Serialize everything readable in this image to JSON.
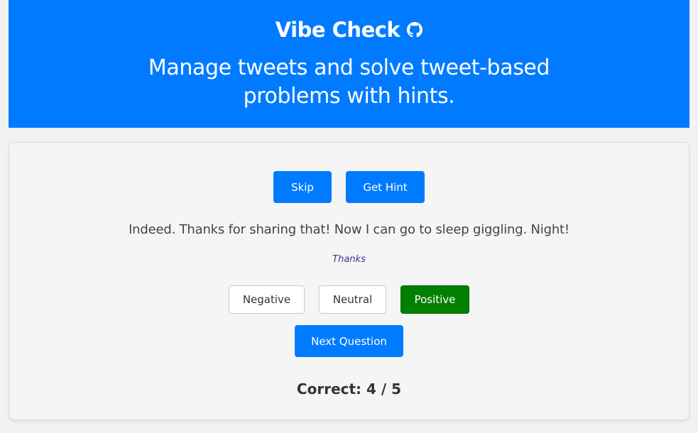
{
  "header": {
    "title": "Vibe Check",
    "icon": "github-icon",
    "subtitle": "Manage tweets and solve tweet-based problems with hints."
  },
  "controls": {
    "skip_label": "Skip",
    "hint_label": "Get Hint"
  },
  "tweet": {
    "text": "Indeed. Thanks for sharing that! Now I can go to sleep giggling. Night!",
    "hint": "Thanks"
  },
  "sentiments": {
    "negative_label": "Negative",
    "neutral_label": "Neutral",
    "positive_label": "Positive",
    "selected": "Positive"
  },
  "next_label": "Next Question",
  "score": {
    "text": "Correct: 4 / 5"
  },
  "colors": {
    "primary": "#007bff",
    "selected_green": "#008000",
    "hint_purple": "#4b2a8a"
  }
}
